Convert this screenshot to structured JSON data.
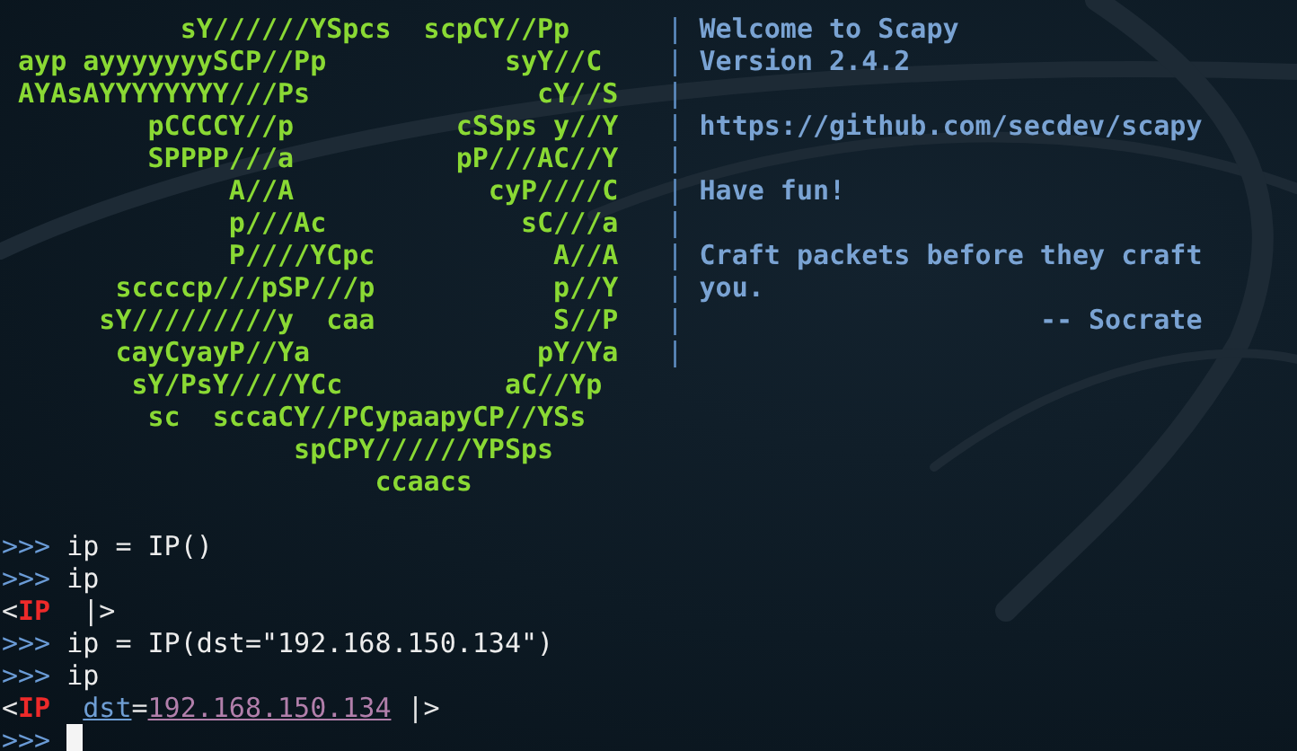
{
  "banner": [
    {
      "art": "          sY//////YSpcs  scpCY//Pp",
      "separator": "|",
      "info": "Welcome to Scapy"
    },
    {
      "art": "ayp ayyyyyyySCP//Pp           syY//C",
      "separator": "|",
      "info": "Version 2.4.2"
    },
    {
      "art": "AYAsAYYYYYYYY///Ps              cY//S",
      "separator": "|"
    },
    {
      "art": "        pCCCCY//p          cSSps y//Y",
      "separator": "|",
      "info": "https://github.com/secdev/scapy"
    },
    {
      "art": "        SPPPP///a          pP///AC//Y",
      "separator": "|"
    },
    {
      "art": "             A//A            cyP////C",
      "separator": "|",
      "info": "Have fun!"
    },
    {
      "art": "             p///Ac            sC///a",
      "separator": "|"
    },
    {
      "art": "             P////YCpc           A//A",
      "separator": "|",
      "info": "Craft packets before they craft"
    },
    {
      "art": "      sccccp///pSP///p           p//Y",
      "separator": "|",
      "info": "you."
    },
    {
      "art": "     sY/////////y  caa           S//P",
      "separator": "|",
      "info": "                     -- Socrate"
    },
    {
      "art": "      cayCyayP//Ya              pY/Ya",
      "separator": "|"
    },
    {
      "art": "       sY/PsY////YCc          aC//Yp"
    },
    {
      "art": "        sc  sccaCY//PCypaapyCP//YSs"
    },
    {
      "art": "                 spCPY//////YPSps"
    },
    {
      "art": "                      ccaacs"
    }
  ],
  "console": [
    {
      "kind": "input",
      "prompt": ">>>",
      "command": "ip = IP()"
    },
    {
      "kind": "input",
      "prompt": ">>>",
      "command": "ip"
    },
    {
      "kind": "output",
      "open": "<",
      "layer": "IP",
      "close": "|>"
    },
    {
      "kind": "input",
      "prompt": ">>>",
      "command": "ip = IP(dst=\"192.168.150.134\")"
    },
    {
      "kind": "input",
      "prompt": ">>>",
      "command": "ip"
    },
    {
      "kind": "output",
      "open": "<",
      "layer": "IP",
      "fields": [
        {
          "name": "dst",
          "separator": "=",
          "value": "192.168.150.134"
        }
      ],
      "close": "|>"
    },
    {
      "kind": "input",
      "prompt": ">>>",
      "cursor": true
    }
  ]
}
